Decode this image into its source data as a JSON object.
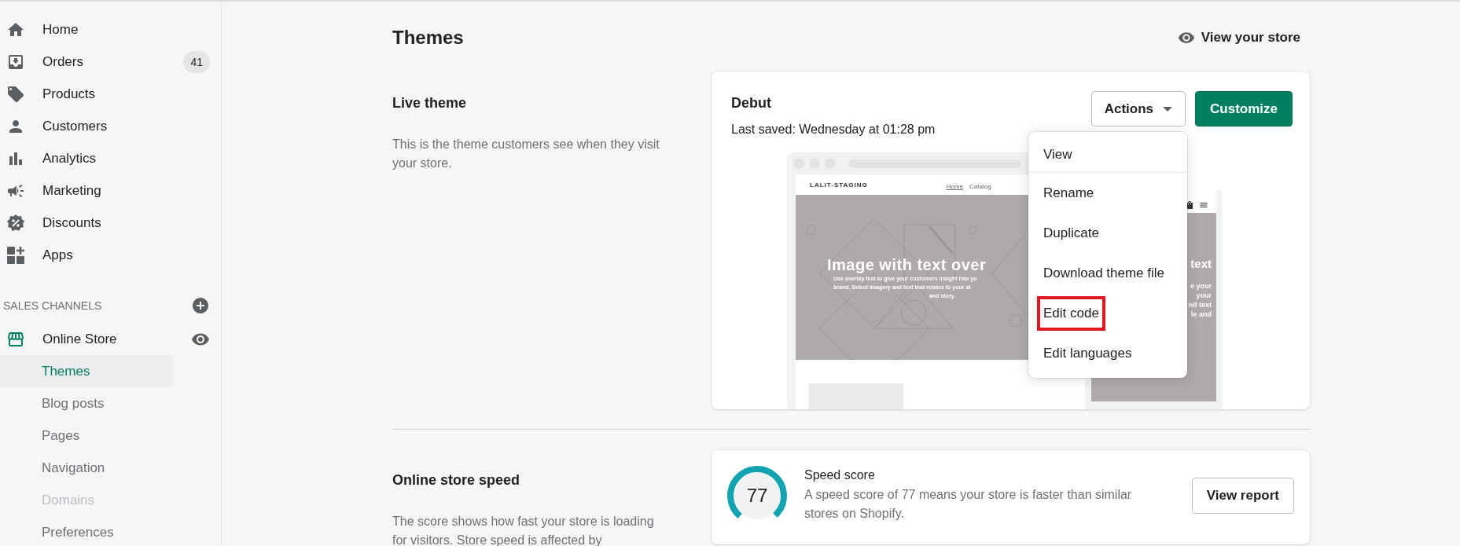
{
  "sidebar": {
    "items": [
      {
        "label": "Home"
      },
      {
        "label": "Orders",
        "badge": "41"
      },
      {
        "label": "Products"
      },
      {
        "label": "Customers"
      },
      {
        "label": "Analytics"
      },
      {
        "label": "Marketing"
      },
      {
        "label": "Discounts"
      },
      {
        "label": "Apps"
      }
    ],
    "channels_heading": "SALES CHANNELS",
    "channels": [
      {
        "label": "Online Store",
        "children": [
          {
            "label": "Themes",
            "selected": true,
            "disabled": false
          },
          {
            "label": "Blog posts",
            "selected": false,
            "disabled": false
          },
          {
            "label": "Pages",
            "selected": false,
            "disabled": false
          },
          {
            "label": "Navigation",
            "selected": false,
            "disabled": false
          },
          {
            "label": "Domains",
            "selected": false,
            "disabled": true
          },
          {
            "label": "Preferences",
            "selected": false,
            "disabled": false
          }
        ]
      }
    ]
  },
  "page": {
    "title": "Themes",
    "view_store": "View your store"
  },
  "live_theme": {
    "heading": "Live theme",
    "description": "This is the theme customers see when they visit your store.",
    "theme_name": "Debut",
    "last_saved": "Last saved: Wednesday at 01:28 pm",
    "actions_button": "Actions",
    "customize_button": "Customize",
    "preview": {
      "store_name": "LALIT-STAGING",
      "nav": [
        "Home",
        "Catalog"
      ],
      "hero_title": "Image with text over",
      "hero_lines": [
        "Use overlay text to give your customers insight into yo",
        "brand. Select imagery and text that relates to your st",
        "and story."
      ],
      "mobile_title": "text",
      "mobile_lines": [
        "e your",
        "your",
        "nd text",
        "le and"
      ]
    },
    "menu": [
      {
        "label": "View",
        "highlighted": false,
        "divider_after": true
      },
      {
        "label": "Rename",
        "highlighted": false,
        "divider_after": false
      },
      {
        "label": "Duplicate",
        "highlighted": false,
        "divider_after": false
      },
      {
        "label": "Download theme file",
        "highlighted": false,
        "divider_after": false
      },
      {
        "label": "Edit code",
        "highlighted": true,
        "divider_after": false
      },
      {
        "label": "Edit languages",
        "highlighted": false,
        "divider_after": false
      }
    ]
  },
  "speed": {
    "heading": "Online store speed",
    "description": "The score shows how fast your store is loading for visitors. Store speed is affected by",
    "score": "77",
    "level": 0.77,
    "title": "Speed score",
    "text": "A speed score of 77 means your store is faster than similar stores on Shopify.",
    "button": "View report"
  }
}
